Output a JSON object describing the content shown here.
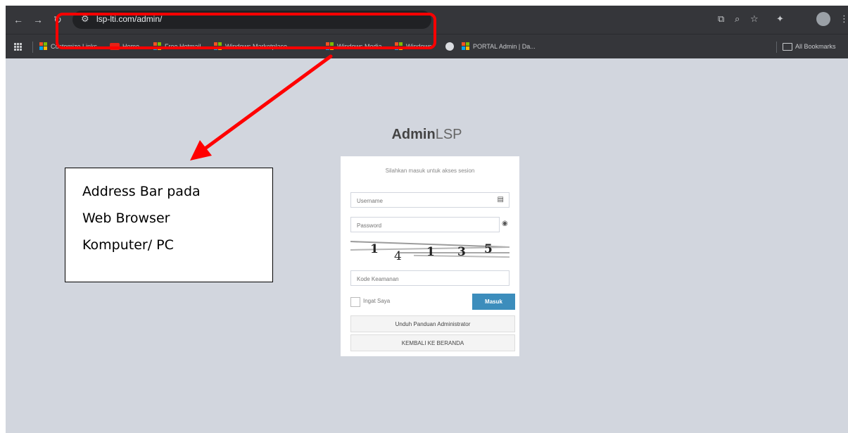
{
  "browser": {
    "url": "lsp-lti.com/admin/",
    "bookmarks": [
      {
        "label": "Customize Links",
        "icon": "windows-icon"
      },
      {
        "label": "Home",
        "icon": "youtube-icon"
      },
      {
        "label": "Free Hotmail",
        "icon": "windows-icon"
      },
      {
        "label": "Windows Marketplace",
        "icon": "windows-icon"
      },
      {
        "label": "Windows Media",
        "icon": "windows-icon"
      },
      {
        "label": "Windows",
        "icon": "windows-icon"
      },
      {
        "label": "PORTAL Admin | Da...",
        "icon": "folder-icon"
      }
    ],
    "all_bookmarks": "All Bookmarks"
  },
  "login": {
    "brand_bold": "Admin",
    "brand_light": "LSP",
    "message": "Silahkan masuk untuk akses sesion",
    "username_placeholder": "Username",
    "password_placeholder": "Password",
    "captcha_digits": [
      "1",
      "4",
      "1",
      "3",
      "5"
    ],
    "captcha_placeholder": "Kode Keamanan",
    "remember_label": "Ingat Saya",
    "submit_label": "Masuk",
    "guide_button": "Unduh Panduan Administrator",
    "back_button": "KEMBALI KE BERANDA"
  },
  "annotation": {
    "lines": [
      "Address Bar pada",
      "Web Browser",
      "Komputer/ PC"
    ],
    "color": "#ff0000"
  }
}
